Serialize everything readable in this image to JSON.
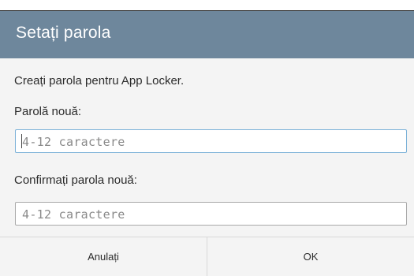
{
  "dialog": {
    "title": "Setați parola",
    "message": "Creați parola pentru App Locker.",
    "new_password_label": "Parolă nouă:",
    "new_password": {
      "value": "",
      "placeholder": "4-12 caractere"
    },
    "confirm_password_label": "Confirmați parola nouă:",
    "confirm_password": {
      "value": "",
      "placeholder": "4-12 caractere"
    },
    "buttons": {
      "cancel": "Anulați",
      "ok": "OK"
    }
  },
  "colors": {
    "title_bar": "#6e879c",
    "title_text": "#ffffff",
    "body_bg": "#f4f4f4",
    "focused_border": "#7bb1d8"
  }
}
